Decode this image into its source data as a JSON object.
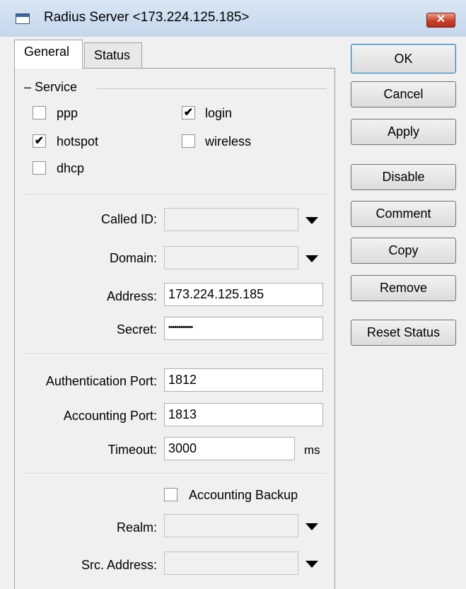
{
  "window": {
    "title": "Radius Server <173.224.125.185>",
    "close_glyph": "✕"
  },
  "tabs": [
    {
      "label": "General"
    },
    {
      "label": "Status"
    }
  ],
  "service": {
    "legend": "Service",
    "options": [
      {
        "label": "ppp",
        "checked": false
      },
      {
        "label": "login",
        "checked": true
      },
      {
        "label": "hotspot",
        "checked": true
      },
      {
        "label": "wireless",
        "checked": false
      },
      {
        "label": "dhcp",
        "checked": false
      }
    ]
  },
  "fields": {
    "called_id": {
      "label": "Called ID:",
      "value": ""
    },
    "domain": {
      "label": "Domain:",
      "value": ""
    },
    "address": {
      "label": "Address:",
      "value": "173.224.125.185"
    },
    "secret": {
      "label": "Secret:",
      "value": "••••••••••••"
    },
    "auth_port": {
      "label": "Authentication Port:",
      "value": "1812"
    },
    "acct_port": {
      "label": "Accounting Port:",
      "value": "1813"
    },
    "timeout": {
      "label": "Timeout:",
      "value": "3000",
      "unit": "ms"
    },
    "accounting_backup": {
      "label": "Accounting Backup",
      "checked": false
    },
    "realm": {
      "label": "Realm:",
      "value": ""
    },
    "src_address": {
      "label": "Src. Address:",
      "value": ""
    }
  },
  "buttons": {
    "ok": "OK",
    "cancel": "Cancel",
    "apply": "Apply",
    "disable": "Disable",
    "comment": "Comment",
    "copy": "Copy",
    "remove": "Remove",
    "reset_status": "Reset Status"
  },
  "check_glyph": "✔"
}
